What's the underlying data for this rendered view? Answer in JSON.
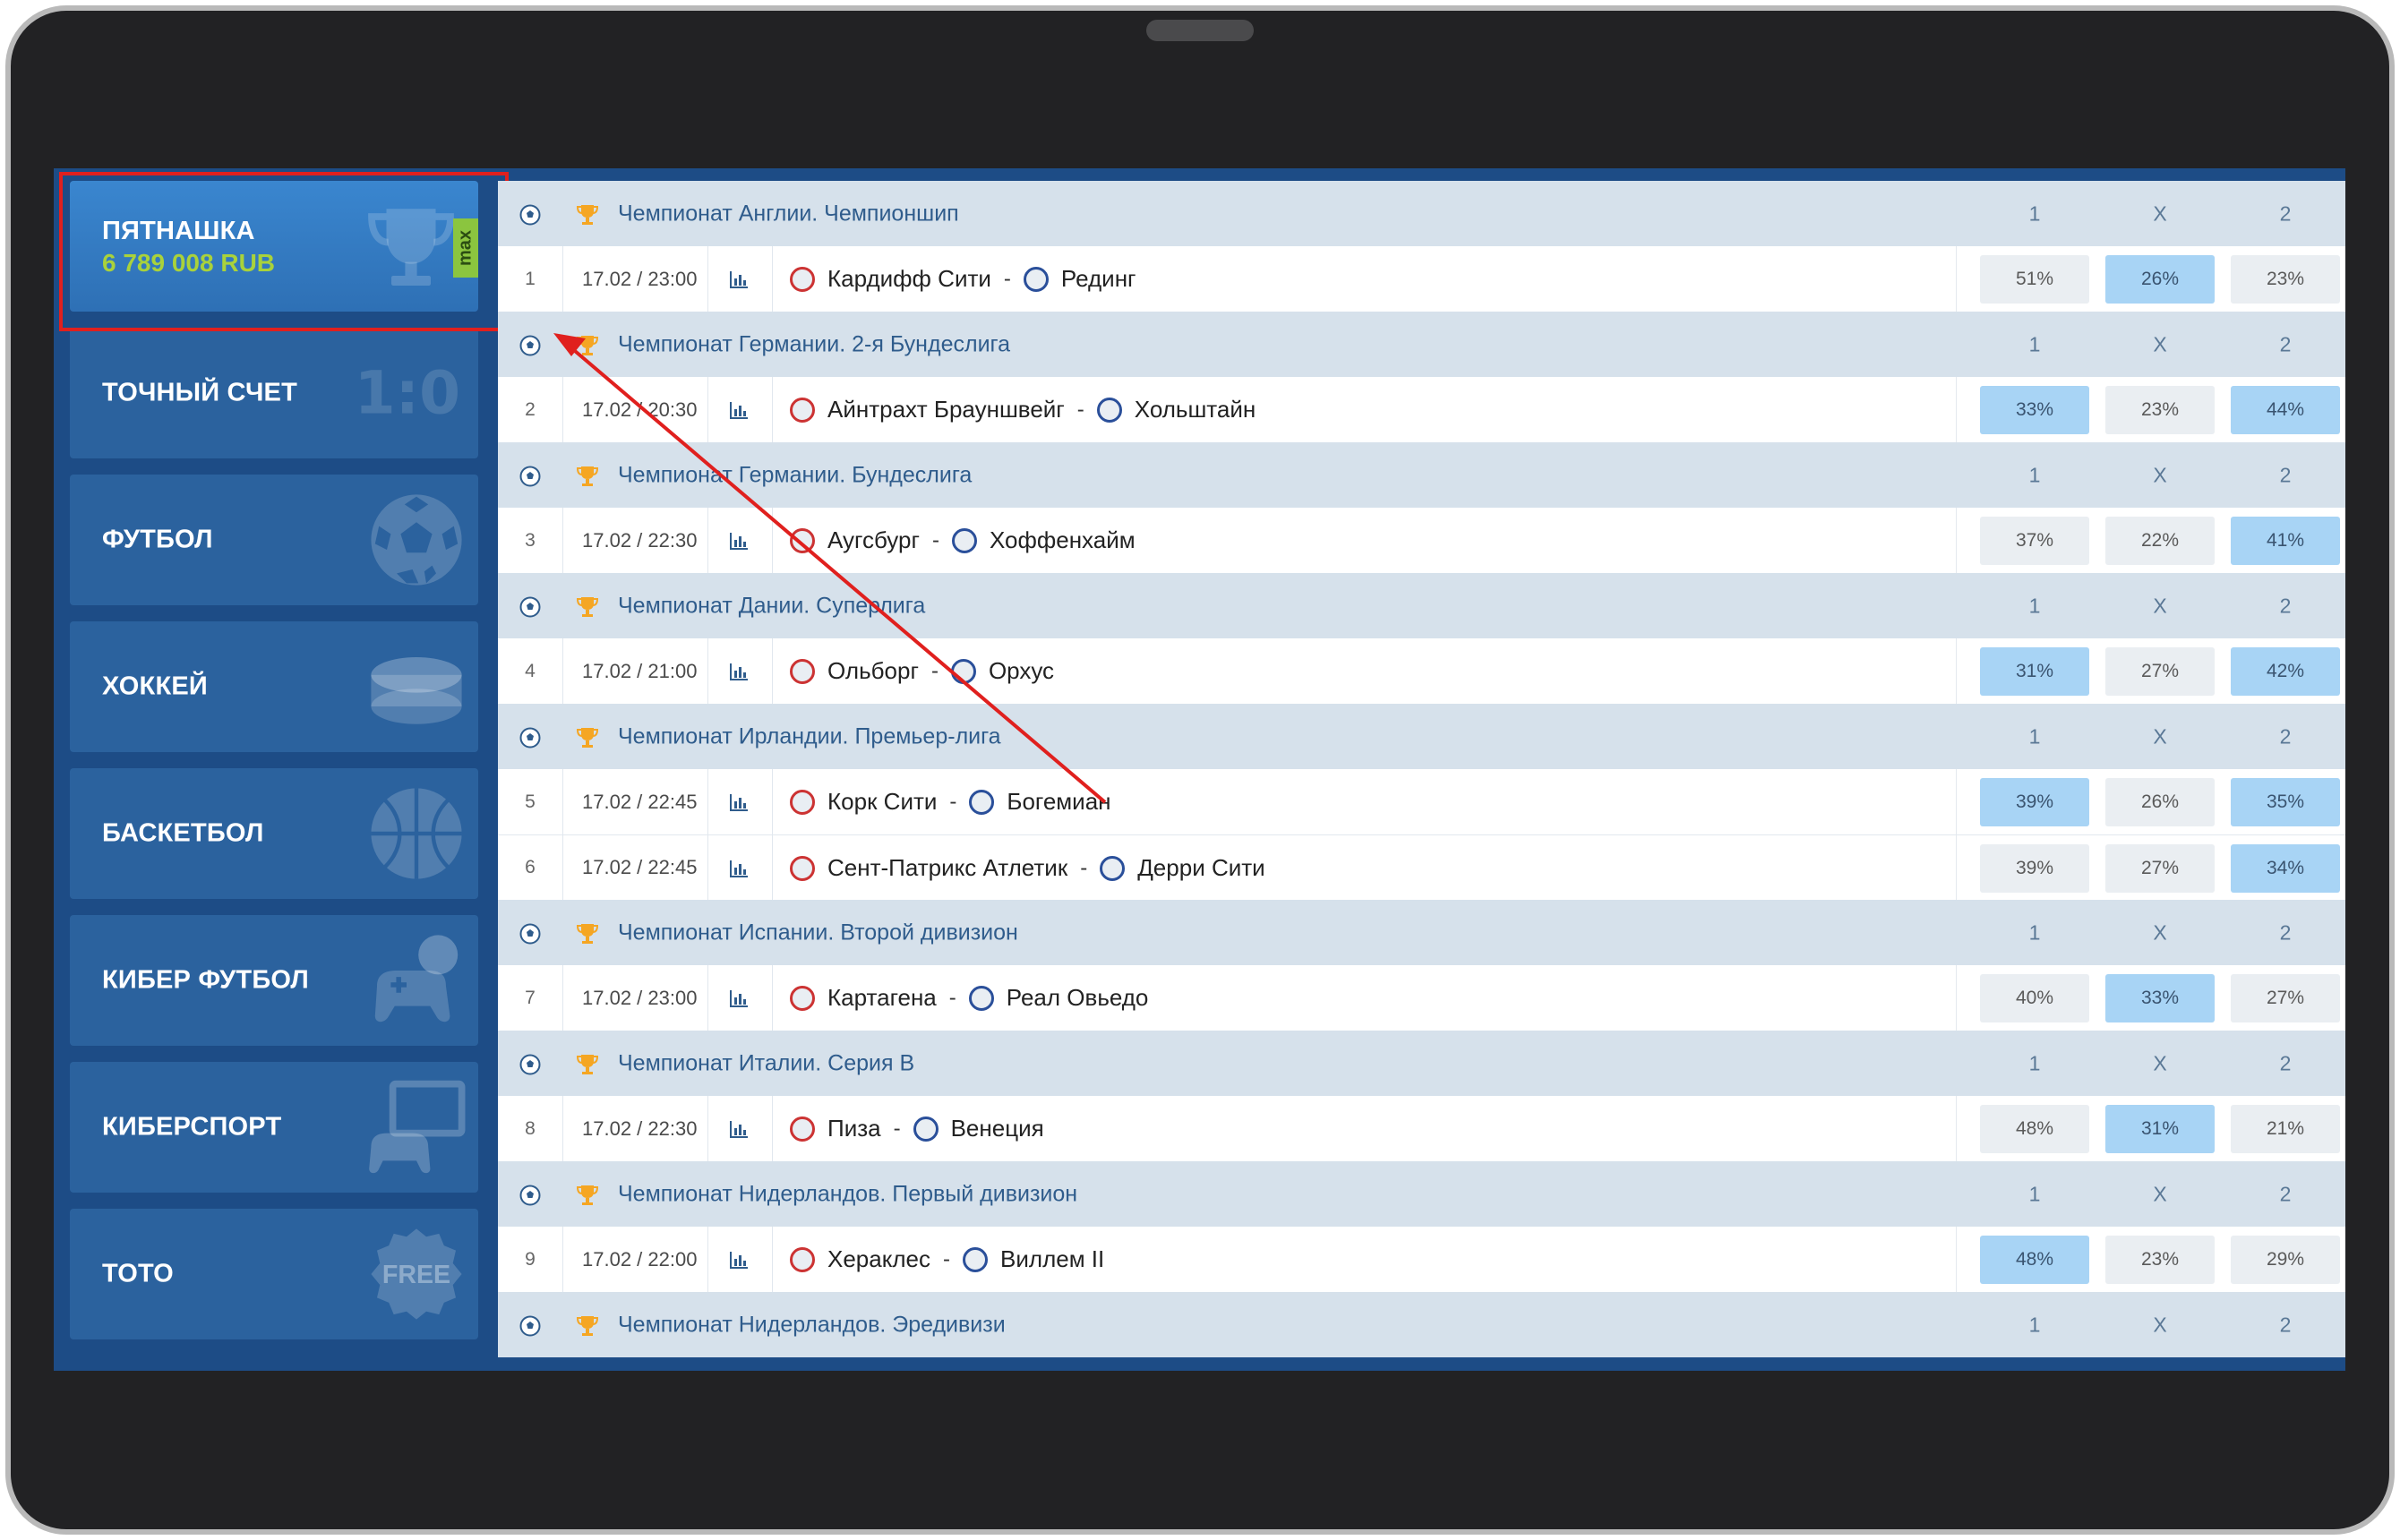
{
  "sidebar": {
    "jackpot": {
      "label": "ПЯТНАШКА",
      "amount": "6 789 008 RUB",
      "badge": "max"
    },
    "items": [
      {
        "label": "ТОЧНЫЙ СЧЕТ",
        "icon": "score-icon",
        "icon_text": "1:0"
      },
      {
        "label": "ФУТБОЛ",
        "icon": "football-icon"
      },
      {
        "label": "ХОККЕЙ",
        "icon": "hockey-puck-icon"
      },
      {
        "label": "БАСКЕТБОЛ",
        "icon": "basketball-icon"
      },
      {
        "label": "КИБЕР ФУТБОЛ",
        "icon": "gamepad-ball-icon"
      },
      {
        "label": "КИБЕРСПОРТ",
        "icon": "monitor-gamepad-icon"
      },
      {
        "label": "ТОТО",
        "icon": "free-badge-icon",
        "icon_text": "FREE"
      }
    ]
  },
  "columns": [
    "1",
    "X",
    "2"
  ],
  "colors": {
    "highlight": "#a8d4f5",
    "normal_cell": "#eaeef2",
    "league_bg": "#d6e1eb",
    "annotation": "#e0201e"
  },
  "leagues": [
    {
      "name": "Чемпионат Англии. Чемпионшип",
      "matches": [
        {
          "n": "1",
          "time": "17.02 / 23:00",
          "home": "Кардифф Сити",
          "away": "Рединг",
          "p": [
            "51%",
            "26%",
            "23%"
          ],
          "hi": 1
        }
      ]
    },
    {
      "name": "Чемпионат Германии. 2-я Бундеслига",
      "matches": [
        {
          "n": "2",
          "time": "17.02 / 20:30",
          "home": "Айнтрахт Брауншвейг",
          "away": "Хольштайн",
          "p": [
            "33%",
            "23%",
            "44%"
          ],
          "hi": [
            0,
            2
          ]
        }
      ]
    },
    {
      "name": "Чемпионат Германии. Бундеслига",
      "matches": [
        {
          "n": "3",
          "time": "17.02 / 22:30",
          "home": "Аугсбург",
          "away": "Хоффенхайм",
          "p": [
            "37%",
            "22%",
            "41%"
          ],
          "hi": 2
        }
      ]
    },
    {
      "name": "Чемпионат Дании. Суперлига",
      "matches": [
        {
          "n": "4",
          "time": "17.02 / 21:00",
          "home": "Ольборг",
          "away": "Орхус",
          "p": [
            "31%",
            "27%",
            "42%"
          ],
          "hi": [
            0,
            2
          ]
        }
      ]
    },
    {
      "name": "Чемпионат Ирландии. Премьер-лига",
      "matches": [
        {
          "n": "5",
          "time": "17.02 / 22:45",
          "home": "Корк Сити",
          "away": "Богемиан",
          "p": [
            "39%",
            "26%",
            "35%"
          ],
          "hi": [
            0,
            2
          ]
        },
        {
          "n": "6",
          "time": "17.02 / 22:45",
          "home": "Сент-Патрикс Атлетик",
          "away": "Дерри Сити",
          "p": [
            "39%",
            "27%",
            "34%"
          ],
          "hi": 2
        }
      ]
    },
    {
      "name": "Чемпионат Испании. Второй дивизион",
      "matches": [
        {
          "n": "7",
          "time": "17.02 / 23:00",
          "home": "Картагена",
          "away": "Реал Овьедо",
          "p": [
            "40%",
            "33%",
            "27%"
          ],
          "hi": 1
        }
      ]
    },
    {
      "name": "Чемпионат Италии. Серия B",
      "matches": [
        {
          "n": "8",
          "time": "17.02 / 22:30",
          "home": "Пиза",
          "away": "Венеция",
          "p": [
            "48%",
            "31%",
            "21%"
          ],
          "hi": 1
        }
      ]
    },
    {
      "name": "Чемпионат Нидерландов. Первый дивизион",
      "matches": [
        {
          "n": "9",
          "time": "17.02 / 22:00",
          "home": "Хераклес",
          "away": "Виллем II",
          "p": [
            "48%",
            "23%",
            "29%"
          ],
          "hi": 0
        }
      ]
    },
    {
      "name": "Чемпионат Нидерландов. Эредивизи",
      "matches": []
    }
  ]
}
